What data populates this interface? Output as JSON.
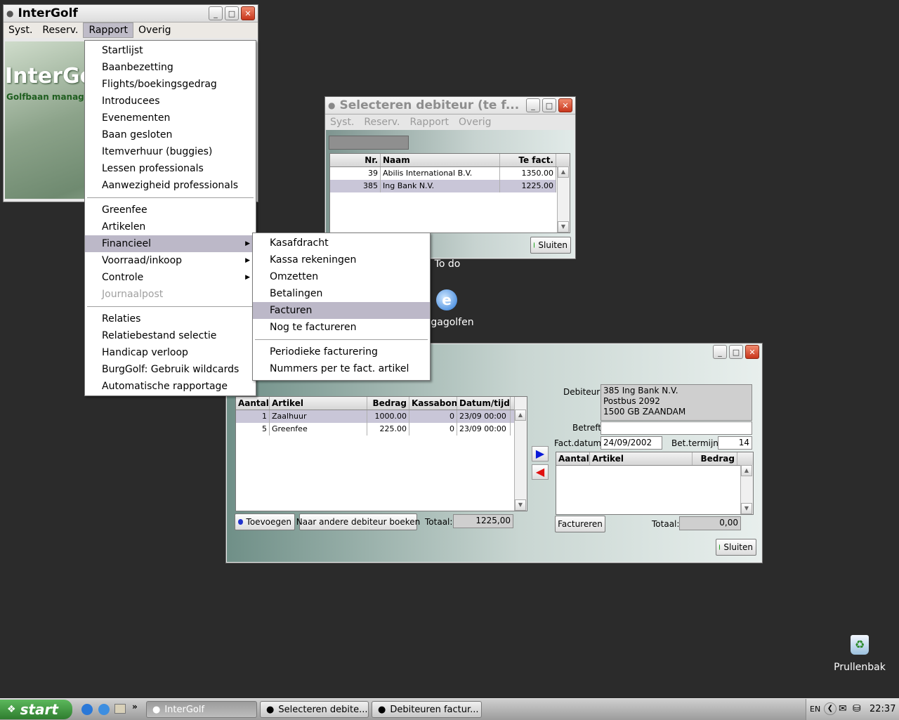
{
  "intergolf": {
    "title": "InterGolf",
    "menus": [
      "Syst.",
      "Reserv.",
      "Rapport",
      "Overig"
    ],
    "banner_title": "InterGol",
    "banner_sub": "Golfbaan managem"
  },
  "rapport_menu": {
    "group1": [
      "Startlijst",
      "Baanbezetting",
      "Flights/boekingsgedrag",
      "Introducees",
      "Evenementen",
      "Baan gesloten",
      "Itemverhuur (buggies)",
      "Lessen professionals",
      "Aanwezigheid professionals"
    ],
    "group2": [
      "Greenfee",
      "Artikelen",
      "Financieel",
      "Voorraad/inkoop",
      "Controle",
      "Journaalpost"
    ],
    "group3": [
      "Relaties",
      "Relatiebestand selectie",
      "Handicap verloop",
      "BurgGolf: Gebruik wildcards",
      "Automatische rapportage"
    ]
  },
  "financieel_menu": {
    "group1": [
      "Kasafdracht",
      "Kassa rekeningen",
      "Omzetten",
      "Betalingen",
      "Facturen",
      "Nog te factureren"
    ],
    "group2": [
      "Periodieke facturering",
      "Nummers per te fact. artikel"
    ]
  },
  "select_window": {
    "title": "Selecteren debiteur (te f...",
    "menus": [
      "Syst.",
      "Reserv.",
      "Rapport",
      "Overig"
    ],
    "columns": [
      "Nr.",
      "Naam",
      "Te fact."
    ],
    "rows": [
      {
        "nr": "39",
        "naam": "Abilis International B.V.",
        "bedrag": "1350.00"
      },
      {
        "nr": "385",
        "naam": "Ing Bank N.V.",
        "bedrag": "1225.00"
      }
    ],
    "close_label": "Sluiten"
  },
  "invoice_window": {
    "columns": [
      "Aantal",
      "Artikel",
      "Bedrag",
      "Kassabon",
      "Datum/tijd"
    ],
    "rows": [
      {
        "aantal": "1",
        "artikel": "Zaalhuur",
        "bedrag": "1000.00",
        "kassabon": "0",
        "datum": "23/09 00:00"
      },
      {
        "aantal": "5",
        "artikel": "Greenfee",
        "bedrag": "225.00",
        "kassabon": "0",
        "datum": "23/09 00:00"
      }
    ],
    "add_label": "Toevoegen",
    "move_label": "Naar andere debiteur boeken",
    "total_label": "Totaal:",
    "total_value": "1225,00",
    "debtor_label": "Debiteur:",
    "debtor_lines": [
      "385 Ing Bank N.V.",
      "Postbus 2092",
      "1500 GB ZAANDAM"
    ],
    "betreft_label": "Betreft:",
    "factdatum_label": "Fact.datum:",
    "factdatum_value": "24/09/2002",
    "betermijn_label": "Bet.termijn:",
    "betermijn_value": "14",
    "right_columns": [
      "Aantal",
      "Artikel",
      "Bedrag"
    ],
    "invoice_label": "Factureren",
    "right_total_label": "Totaal:",
    "right_total_value": "0,00",
    "close_label": "Sluiten"
  },
  "desktop": {
    "todo_label": "To do",
    "golf_label": "gagolfen",
    "recycle_label": "Prullenbak"
  },
  "taskbar": {
    "start_label": "start",
    "tasks": [
      "InterGolf",
      "Selecteren debite...",
      "Debiteuren factur..."
    ],
    "lang": "EN",
    "clock": "22:37"
  }
}
